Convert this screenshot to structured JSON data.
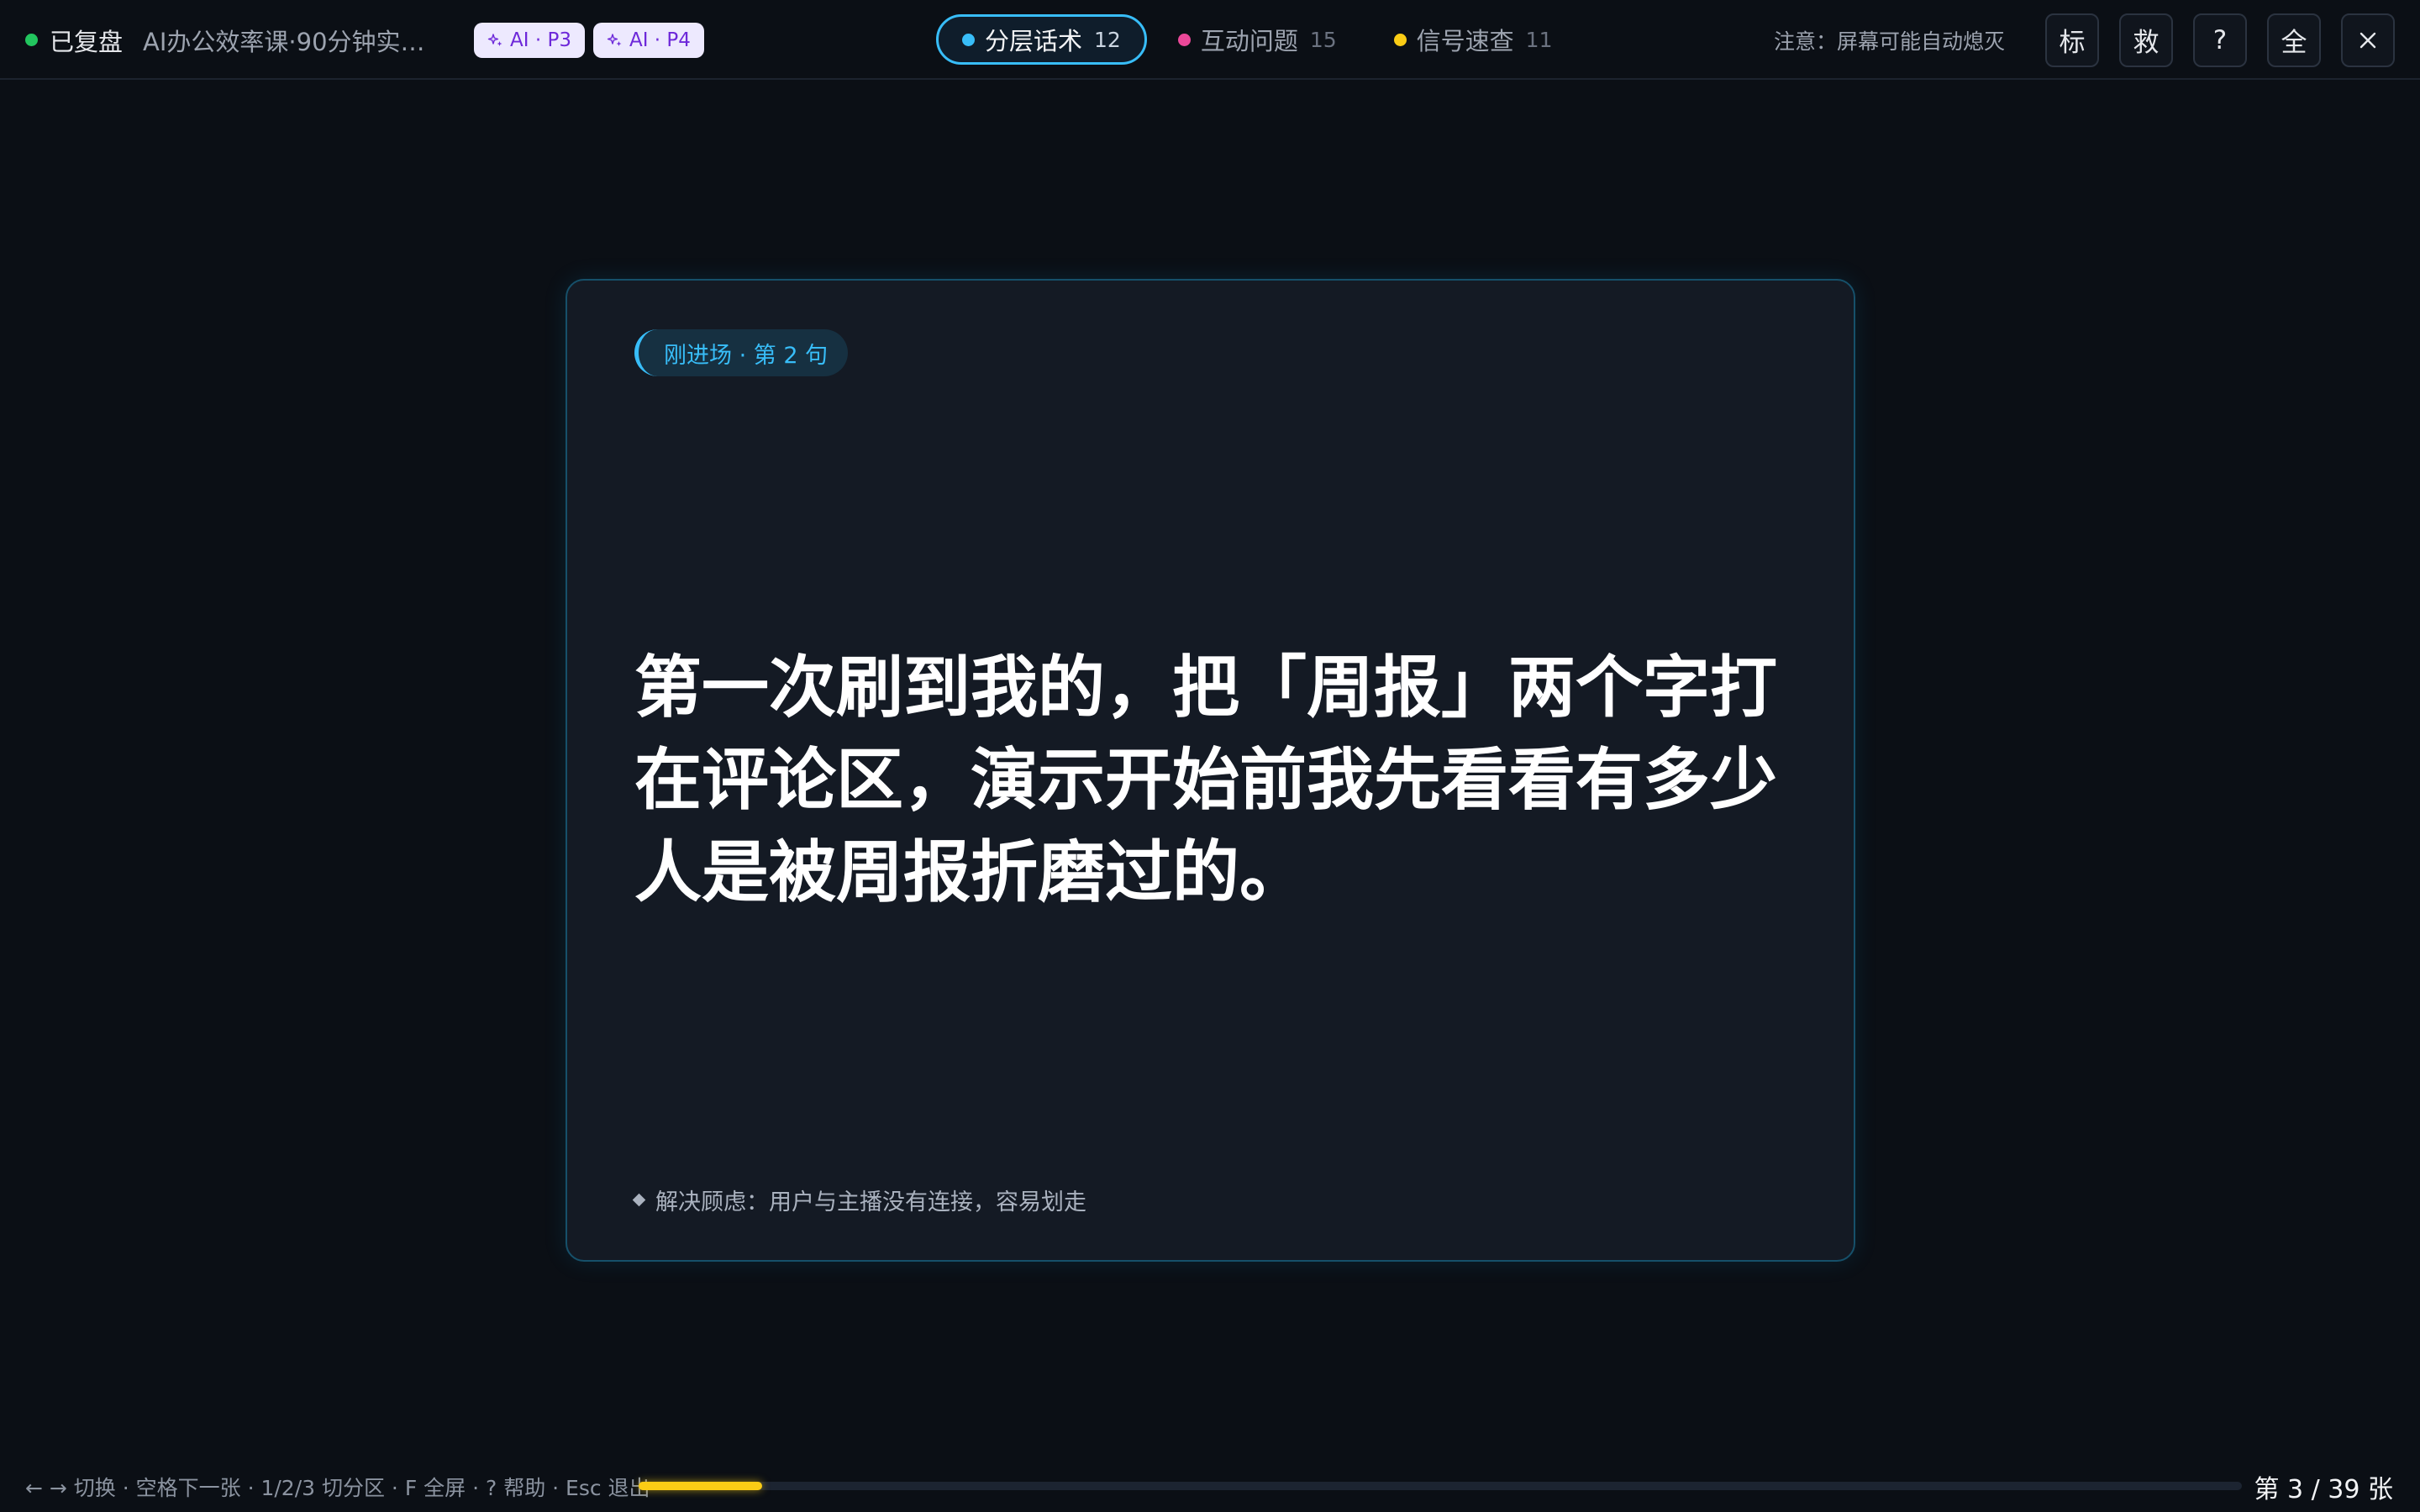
{
  "topbar": {
    "status_label": "已复盘",
    "status_color": "#22c55e",
    "doc_title": "AI办公效率课·90分钟实战...",
    "ai_chips": [
      {
        "label": "AI · P3",
        "icon": "sparkle-icon"
      },
      {
        "label": "AI · P4",
        "icon": "sparkle-icon"
      }
    ],
    "tabs": [
      {
        "label": "分层话术",
        "count": "12",
        "color": "#38bdf8",
        "active": true
      },
      {
        "label": "互动问题",
        "count": "15",
        "color": "#ec4899",
        "active": false
      },
      {
        "label": "信号速查",
        "count": "11",
        "color": "#facc15",
        "active": false
      }
    ],
    "notice": "注意：屏幕可能自动熄灭",
    "buttons": {
      "mark": "标",
      "rescue": "救",
      "help": "?",
      "fullscreen": "全",
      "close_icon": "close-icon"
    }
  },
  "card": {
    "tag": "刚进场 · 第 2 句",
    "quote": "第一次刷到我的，把「周报」两个字打在评论区，演示开始前我先看看有多少人是被周报折磨过的。",
    "footnote": "解决顾虑：用户与主播没有连接，容易划走",
    "accent_color": "#38bdf8"
  },
  "bottombar": {
    "shortcuts": "← → 切换 · 空格下一张 · 1/2/3 切分区 · F 全屏 · ? 帮助 · Esc 退出",
    "progress": 0.077,
    "progress_color": "#facc15",
    "page_counter": "第 3 / 39 张"
  }
}
